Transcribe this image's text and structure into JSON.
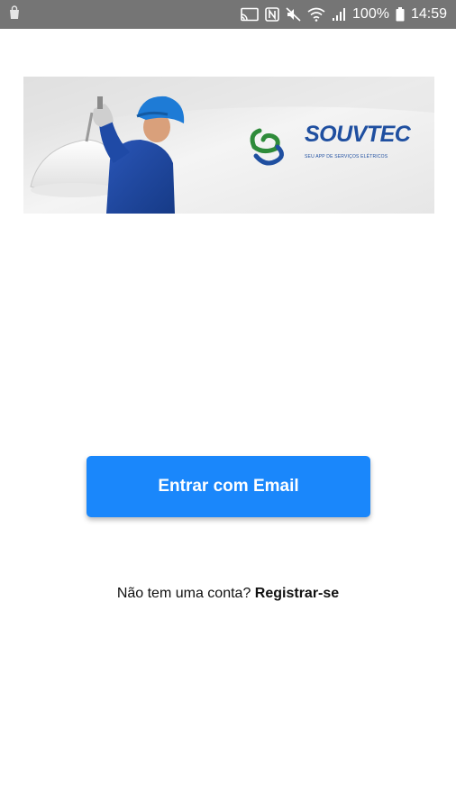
{
  "status_bar": {
    "battery_percent": "100%",
    "time": "14:59",
    "icons": [
      "bag-icon",
      "cast-icon",
      "nfc-icon",
      "mute-icon",
      "wifi-icon",
      "signal-icon",
      "battery-icon"
    ]
  },
  "banner": {
    "brand_name": "SOUVTEC",
    "tagline": "SEU APP DE SERVIÇOS ELÉTRICOS",
    "colors": {
      "brand_blue": "#1f4fa0",
      "brand_green": "#2e8b3a"
    }
  },
  "actions": {
    "email_button_label": "Entrar com Email",
    "email_button_color": "#1a87fb"
  },
  "register": {
    "prompt": "Não tem uma conta?",
    "link_label": "Registrar-se"
  }
}
